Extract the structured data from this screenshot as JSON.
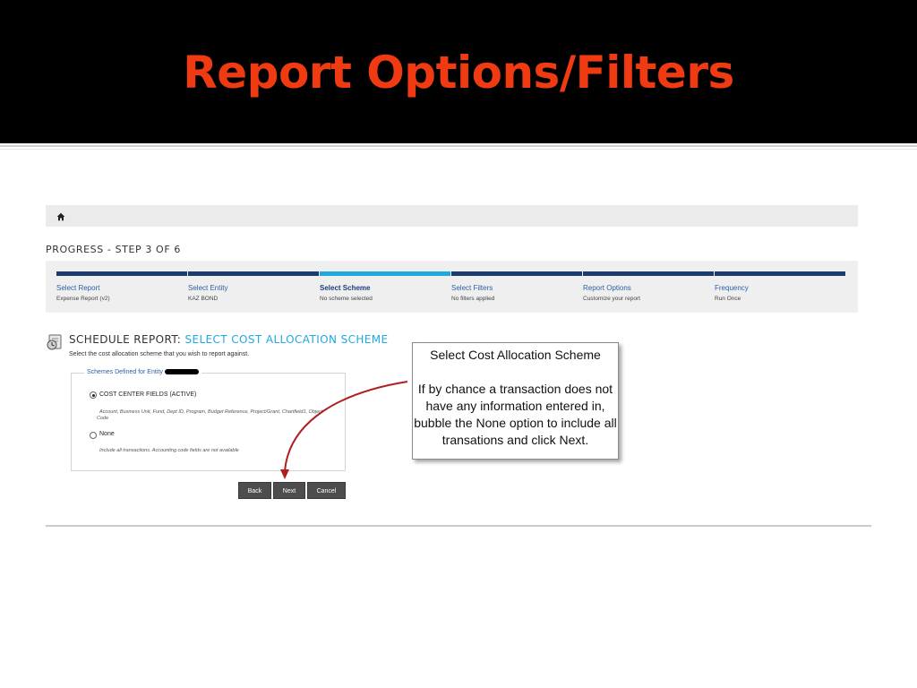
{
  "slide": {
    "title": "Report Options/Filters"
  },
  "progress": {
    "title": "PROGRESS - STEP 3 OF 6",
    "steps": [
      {
        "label": "Select Report",
        "sub": "Expense Report (v2)"
      },
      {
        "label": "Select Entity",
        "sub": "KAZ BOND"
      },
      {
        "label": "Select Scheme",
        "sub": "No scheme selected"
      },
      {
        "label": "Select Filters",
        "sub": "No filters applied"
      },
      {
        "label": "Report Options",
        "sub": "Customize your report"
      },
      {
        "label": "Frequency",
        "sub": "Run Once"
      }
    ]
  },
  "schedule": {
    "title_prefix": "SCHEDULE REPORT:",
    "title_accent": "SELECT COST ALLOCATION SCHEME",
    "description": "Select the cost allocation scheme that you wish to report against.",
    "schemes_legend": "Schemes Defined for Entity",
    "options": [
      {
        "label": "COST CENTER FIELDS (ACTIVE)",
        "description": "Account, Business Unit, Fund, Dept ID, Program, Budget Reference, Project/Grant, Chartfield1, Object Code",
        "selected": true
      },
      {
        "label": "None",
        "description": "Include all transactions. Accounting code fields are not available",
        "selected": false
      }
    ],
    "buttons": {
      "back": "Back",
      "next": "Next",
      "cancel": "Cancel"
    }
  },
  "callout": {
    "title": "Select Cost Allocation Scheme",
    "body": "If by chance a transaction does not have any information entered in, bubble the None option to include all transations and click Next."
  },
  "colors": {
    "title": "#f03a12",
    "accent": "#21a8e0",
    "step_bar": "#1a3c6e",
    "active_step_bar": "#20a9e1",
    "arrow": "#b01e22"
  }
}
